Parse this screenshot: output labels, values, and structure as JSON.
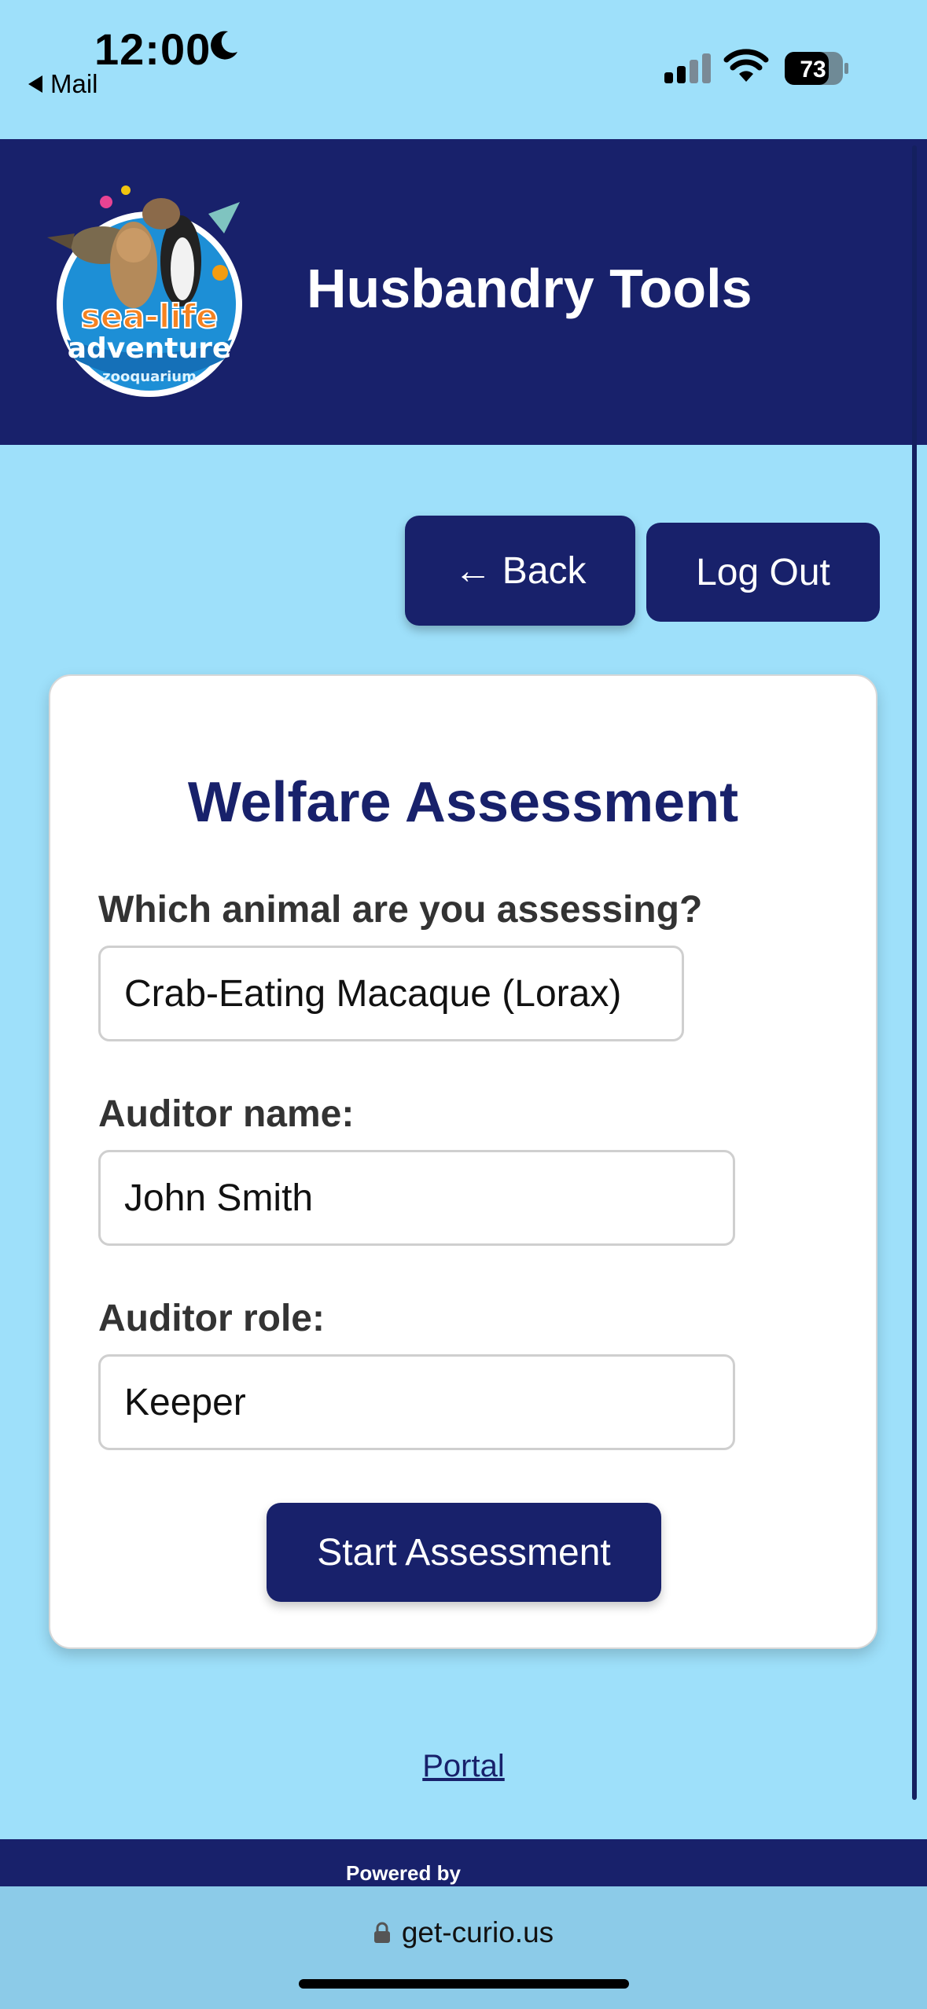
{
  "status_bar": {
    "time": "12:00",
    "back_app": "Mail",
    "battery": "73"
  },
  "header": {
    "title": "Husbandry Tools",
    "logo": {
      "brand_line1": "sea-life",
      "brand_line2": "adventure",
      "brand_line3": "zooquarium"
    }
  },
  "nav": {
    "back_label": "← Back",
    "logout_label": "Log Out"
  },
  "form": {
    "title": "Welfare Assessment",
    "animal_label": "Which animal are you assessing?",
    "animal_value": "Crab-Eating Macaque (Lorax)",
    "auditor_name_label": "Auditor name:",
    "auditor_name_value": "John Smith",
    "auditor_role_label": "Auditor role:",
    "auditor_role_value": "Keeper",
    "start_label": "Start Assessment"
  },
  "portal_link": "Portal",
  "footer": {
    "powered_by": "Powered by",
    "url": "get-curio.us"
  },
  "colors": {
    "navy": "#18216b",
    "background": "#9ee0fa",
    "card": "#ffffff"
  }
}
